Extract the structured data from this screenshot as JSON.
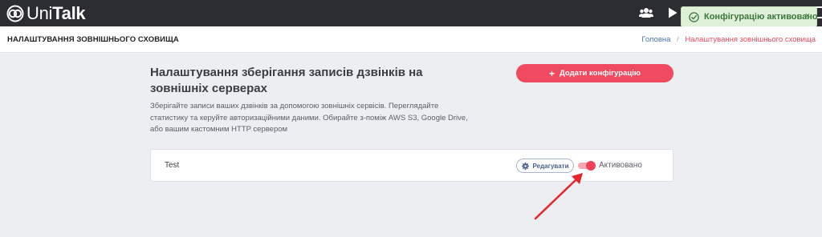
{
  "app": {
    "logo_text_light": "Uni",
    "logo_text_bold": "Talk"
  },
  "icons": {
    "logo": "unitalk-logo-icon",
    "users": "users-icon",
    "play": "play-icon",
    "check": "check-circle-icon",
    "gear": "gear-icon",
    "arrow": "red-arrow-annotation"
  },
  "toast": {
    "message": "Конфігурацію активовано",
    "close_label": "×"
  },
  "page": {
    "title": "НАЛАШТУВАННЯ ЗОВНІШНЬОГО СХОВИЩА",
    "breadcrumb": {
      "home": "Головна",
      "separator": "/",
      "current": "Налаштування зовнішнього сховища"
    }
  },
  "main": {
    "heading": "Налаштування зберігання записів дзвінків на зовнішніх серверах",
    "description": "Зберігайте записи ваших дзвінків за допомогою зовнішніх сервісів. Переглядайте статистику та керуйте авторизаційними даними. Обирайте з-поміж AWS S3, Google Drive, або вашим кастомним HTTP сервером",
    "add_button": {
      "plus": "+",
      "label": "Додати конфігурацію"
    }
  },
  "configurations": [
    {
      "name": "Test",
      "edit_label": "Редагувати",
      "status_label": "Активовано",
      "active": true
    }
  ],
  "colors": {
    "topbar": "#2b2d33",
    "accent": "#ef4a5f",
    "toast_bg": "#dff0d8",
    "toast_text": "#3c763d",
    "breadcrumb_link": "#4b74a8",
    "arrow": "#e5252a"
  }
}
